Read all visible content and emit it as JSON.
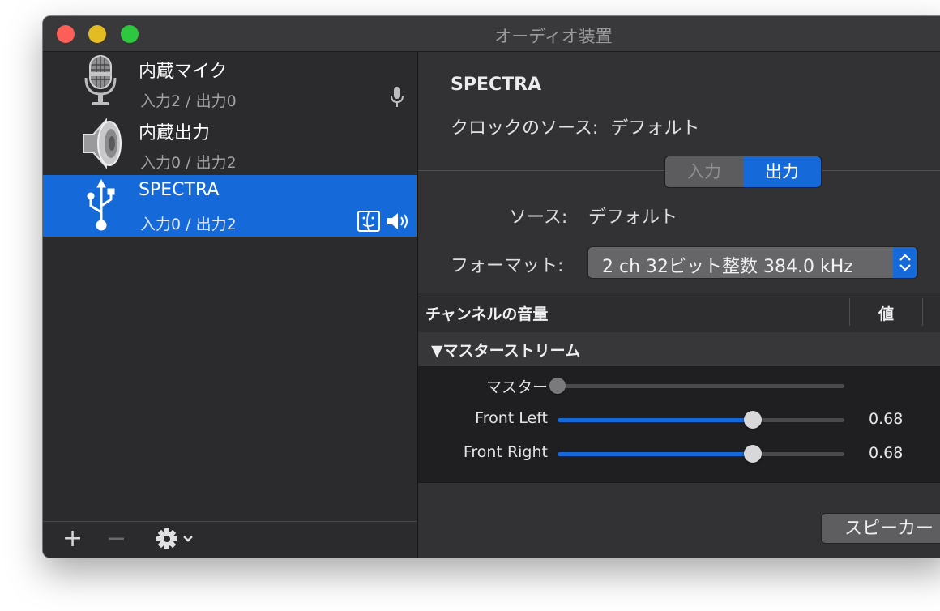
{
  "window": {
    "title": "オーディオ装置"
  },
  "devices": [
    {
      "name": "内蔵マイク",
      "io": "入力2 / 出力0",
      "icon": "microphone-icon",
      "badge": "mic-badge-icon"
    },
    {
      "name": "内蔵出力",
      "io": "入力0 / 出力2",
      "icon": "speaker-icon"
    },
    {
      "name": "SPECTRA",
      "io": "入力0 / 出力2",
      "icon": "usb-icon",
      "badges": [
        "finder-badge-icon",
        "volume-badge-icon"
      ],
      "selected": true
    }
  ],
  "sidebar_toolbar": {
    "add": "+",
    "remove": "−",
    "action": "gear-icon"
  },
  "detail": {
    "device_title": "SPECTRA",
    "clock_label": "クロックのソース:",
    "clock_value": "デフォルト",
    "tabs": [
      "入力",
      "出力"
    ],
    "selected_tab": "出力",
    "source_label": "ソース:",
    "source_value": "デフォルト",
    "format_label": "フォーマット:",
    "format_value": "2 ch 32ビット整数 384.0 kHz",
    "table": {
      "col_channel": "チャンネルの音量",
      "col_value": "値"
    },
    "group_title": "▼マスターストリーム",
    "channels": [
      {
        "label": "マスター",
        "level": 0.0,
        "value": "",
        "enabled": false
      },
      {
        "label": "Front Left",
        "level": 0.68,
        "value": "0.68",
        "enabled": true
      },
      {
        "label": "Front Right",
        "level": 0.68,
        "value": "0.68",
        "enabled": true
      }
    ],
    "speaker_button": "スピーカー"
  },
  "colors": {
    "accent": "#1669d9",
    "background": "#2b2b2d"
  }
}
